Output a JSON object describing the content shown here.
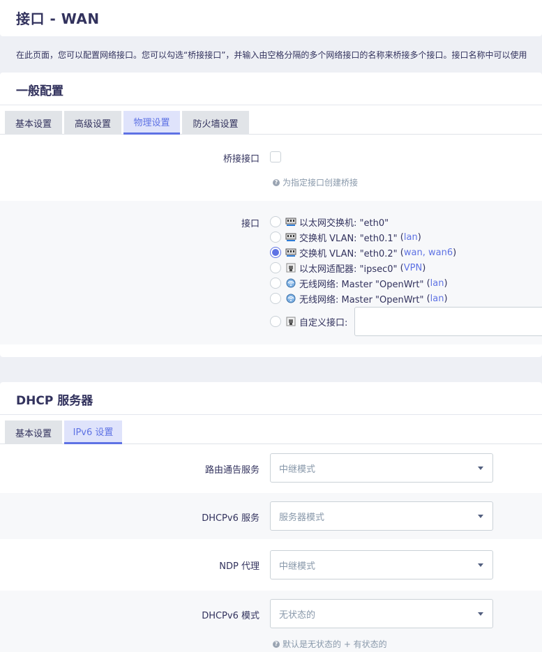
{
  "header": {
    "title": "接口 - WAN"
  },
  "description": "在此页面，您可以配置网络接口。您可以勾选“桥接接口”，并输入由空格分隔的多个网络接口的名称来桥接多个接口。接口名称中可以使用",
  "general": {
    "title": "一般配置",
    "tabs": [
      {
        "label": "基本设置",
        "active": false
      },
      {
        "label": "高级设置",
        "active": false
      },
      {
        "label": "物理设置",
        "active": true
      },
      {
        "label": "防火墙设置",
        "active": false
      }
    ],
    "bridge": {
      "label": "桥接接口",
      "checked": false,
      "hint": "为指定接口创建桥接"
    },
    "interface": {
      "label": "接口",
      "options": [
        {
          "icon": "switch-icon",
          "text": "以太网交换机: \"eth0\"",
          "open": "",
          "links": "",
          "close": "",
          "checked": false
        },
        {
          "icon": "switch-icon",
          "text": "交换机 VLAN: \"eth0.1\" ",
          "open": "(",
          "links": "lan",
          "close": ")",
          "checked": false
        },
        {
          "icon": "switch-icon",
          "text": "交换机 VLAN: \"eth0.2\" ",
          "open": "(",
          "links": "wan, wan6",
          "close": ")",
          "checked": true
        },
        {
          "icon": "ethernet-adapter-icon",
          "text": "以太网适配器: \"ipsec0\" ",
          "open": "(",
          "links": "VPN",
          "close": ")",
          "checked": false
        },
        {
          "icon": "wifi-icon",
          "text": "无线网络: Master \"OpenWrt\" ",
          "open": "(",
          "links": "lan",
          "close": ")",
          "checked": false
        },
        {
          "icon": "wifi-icon",
          "text": "无线网络: Master \"OpenWrt\" ",
          "open": "(",
          "links": "lan",
          "close": ")",
          "checked": false
        }
      ],
      "custom": {
        "label": "自定义接口:",
        "value": ""
      }
    }
  },
  "dhcp": {
    "title": "DHCP 服务器",
    "tabs": [
      {
        "label": "基本设置",
        "active": false
      },
      {
        "label": "IPv6 设置",
        "active": true
      }
    ],
    "fields": [
      {
        "label": "路由通告服务",
        "value": "中继模式"
      },
      {
        "label": "DHCPv6 服务",
        "value": "服务器模式"
      },
      {
        "label": "NDP 代理",
        "value": "中继模式"
      },
      {
        "label": "DHCPv6 模式",
        "value": "无状态的"
      }
    ],
    "mode_hint": "默认是无状态的 + 有状态的"
  },
  "colors": {
    "accent": "#5e72e4",
    "text": "#32325d",
    "muted": "#8898aa",
    "background": "#eef0f5"
  }
}
